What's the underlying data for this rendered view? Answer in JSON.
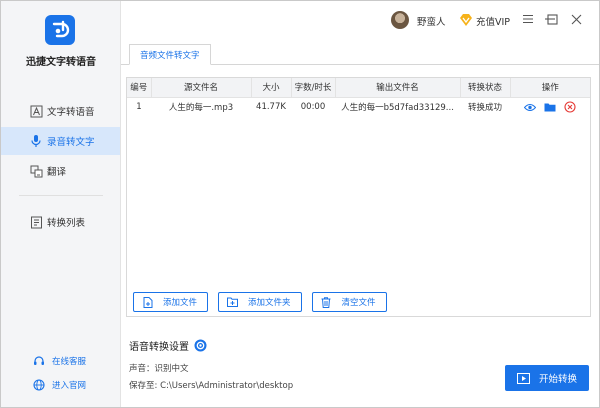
{
  "app": {
    "title": "迅捷文字转语音",
    "brand_color": "#1a73e8"
  },
  "sidebar": {
    "items": [
      {
        "label": "文字转语音",
        "icon": "text-a-icon",
        "active": false
      },
      {
        "label": "录音转文字",
        "icon": "microphone-icon",
        "active": true
      },
      {
        "label": "翻译",
        "icon": "translate-icon",
        "active": false
      },
      {
        "label": "转换列表",
        "icon": "list-icon",
        "active": false
      }
    ],
    "links": [
      {
        "label": "在线客服",
        "icon": "headset-icon"
      },
      {
        "label": "进入官网",
        "icon": "globe-icon"
      }
    ]
  },
  "header": {
    "username": "野蛮人",
    "vip_label": "充值VIP",
    "window_buttons": [
      "menu-icon",
      "minimize-icon",
      "maximize-icon",
      "close-icon"
    ]
  },
  "tabs": [
    {
      "label": "音频文件转文字",
      "active": true
    }
  ],
  "table": {
    "columns": [
      "编号",
      "源文件名",
      "大小",
      "字数/时长",
      "输出文件名",
      "转换状态",
      "操作"
    ],
    "rows": [
      {
        "index": "1",
        "source": "人生的每一.mp3",
        "size": "41.77K",
        "duration": "00:00",
        "output": "人生的每一b5d7fad33129...",
        "status": "转换成功"
      }
    ],
    "row_actions": [
      "eye-icon",
      "folder-icon",
      "delete-icon"
    ]
  },
  "actions": {
    "add_file": "添加文件",
    "add_folder": "添加文件夹",
    "clear_files": "清空文件"
  },
  "settings": {
    "title": "语音转换设置",
    "voice_label": "声音：识别中文",
    "save_label": "保存至: C:\\Users\\Administrator\\desktop"
  },
  "start_button": "开始转换"
}
